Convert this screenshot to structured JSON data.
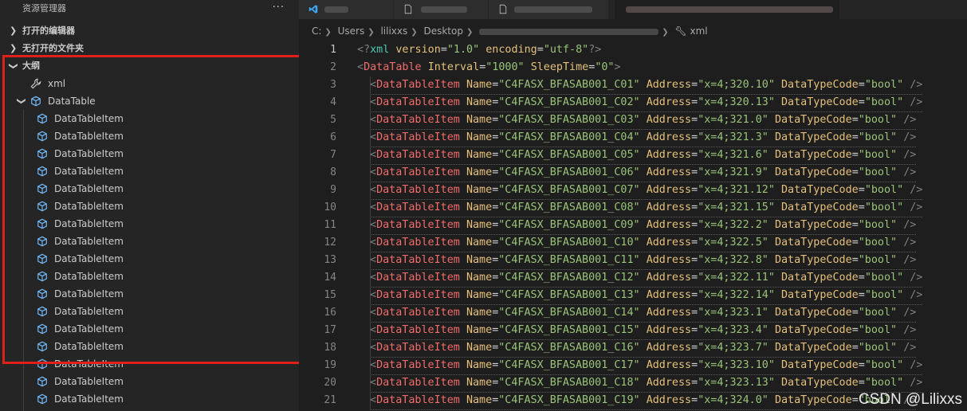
{
  "sidebar": {
    "title": "资源管理器",
    "more": "···",
    "sections": {
      "open_editors": "打开的编辑器",
      "no_folder": "无打开的文件夹",
      "outline": "大纲"
    },
    "outline": {
      "root": "xml",
      "parent": "DataTable",
      "child_label": "DataTableItem",
      "child_count": 17
    }
  },
  "tabs": [
    {
      "label": "",
      "active": false
    },
    {
      "label": "",
      "active": false
    },
    {
      "label": "",
      "active": false
    },
    {
      "label": "",
      "active": true
    }
  ],
  "breadcrumb": {
    "drive": "C:",
    "users": "Users",
    "user": "lilixxs",
    "desktop": "Desktop",
    "symbol": "xml"
  },
  "editor": {
    "line1": {
      "open": "<?",
      "name": "xml",
      "a1": "version",
      "v1": "\"1.0\"",
      "a2": "encoding",
      "v2": "\"utf-8\"",
      "close": "?>"
    },
    "line2": {
      "open": "<",
      "tag": "DataTable",
      "a1": "Interval",
      "v1": "\"1000\"",
      "a2": "SleepTime",
      "v2": "\"0\"",
      "close": ">"
    },
    "items": [
      {
        "name": "\"C4FASX_BFASAB001_C01\"",
        "addr": "\"x=4;320.10\""
      },
      {
        "name": "\"C4FASX_BFASAB001_C02\"",
        "addr": "\"x=4;320.13\""
      },
      {
        "name": "\"C4FASX_BFASAB001_C03\"",
        "addr": "\"x=4;321.0\""
      },
      {
        "name": "\"C4FASX_BFASAB001_C04\"",
        "addr": "\"x=4;321.3\""
      },
      {
        "name": "\"C4FASX_BFASAB001_C05\"",
        "addr": "\"x=4;321.6\""
      },
      {
        "name": "\"C4FASX_BFASAB001_C06\"",
        "addr": "\"x=4;321.9\""
      },
      {
        "name": "\"C4FASX_BFASAB001_C07\"",
        "addr": "\"x=4;321.12\""
      },
      {
        "name": "\"C4FASX_BFASAB001_C08\"",
        "addr": "\"x=4;321.15\""
      },
      {
        "name": "\"C4FASX_BFASAB001_C09\"",
        "addr": "\"x=4;322.2\""
      },
      {
        "name": "\"C4FASX_BFASAB001_C10\"",
        "addr": "\"x=4;322.5\""
      },
      {
        "name": "\"C4FASX_BFASAB001_C11\"",
        "addr": "\"x=4;322.8\""
      },
      {
        "name": "\"C4FASX_BFASAB001_C12\"",
        "addr": "\"x=4;322.11\""
      },
      {
        "name": "\"C4FASX_BFASAB001_C13\"",
        "addr": "\"x=4;322.14\""
      },
      {
        "name": "\"C4FASX_BFASAB001_C14\"",
        "addr": "\"x=4;323.1\""
      },
      {
        "name": "\"C4FASX_BFASAB001_C15\"",
        "addr": "\"x=4;323.4\""
      },
      {
        "name": "\"C4FASX_BFASAB001_C16\"",
        "addr": "\"x=4;323.7\""
      },
      {
        "name": "\"C4FASX_BFASAB001_C17\"",
        "addr": "\"x=4;323.10\""
      },
      {
        "name": "\"C4FASX_BFASAB001_C18\"",
        "addr": "\"x=4;323.13\""
      },
      {
        "name": "\"C4FASX_BFASAB001_C19\"",
        "addr": "\"x=4;324.0\""
      }
    ],
    "item_tag": "DataTableItem",
    "attr_name": "Name",
    "attr_address": "Address",
    "attr_type": "DataTypeCode",
    "type_value": "\"bool\"",
    "self_close": "/>",
    "line_numbers": [
      "1",
      "2",
      "3",
      "4",
      "5",
      "6",
      "7",
      "8",
      "9",
      "10",
      "11",
      "12",
      "13",
      "14",
      "15",
      "16",
      "17",
      "18",
      "19",
      "20",
      "21"
    ]
  },
  "watermark": "CSDN @Lilixxs",
  "colors": {
    "highlight_border": "#e0201b",
    "tag": "#f26b6b",
    "attr": "#e5c07b",
    "string": "#98c379"
  },
  "icons": [
    "chevron-right-icon",
    "chevron-down-icon",
    "wrench-icon",
    "cube-icon",
    "vscode-icon",
    "file-icon"
  ]
}
